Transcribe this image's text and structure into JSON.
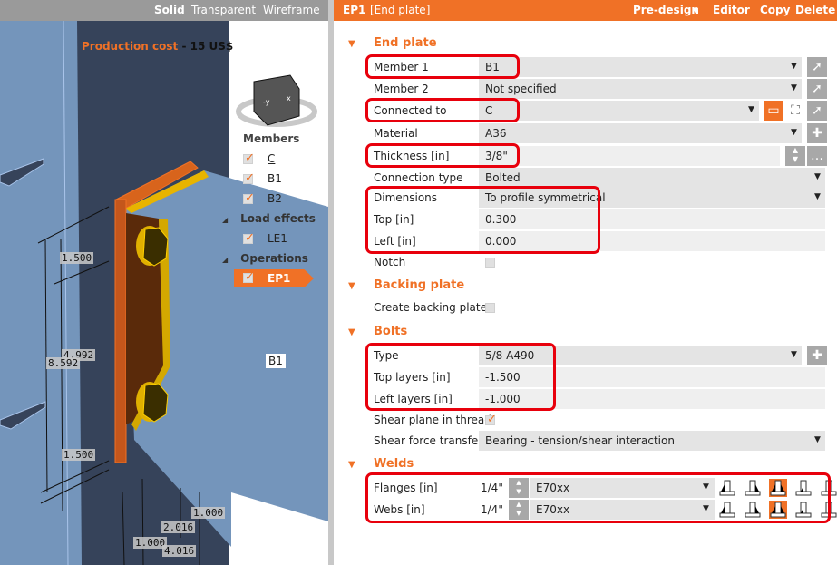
{
  "view_tabs": [
    "Solid",
    "Transparent",
    "Wireframe"
  ],
  "production_cost": {
    "label": "Production cost",
    "sep": "-",
    "value": "15 US$"
  },
  "tree": {
    "members_label": "Members",
    "members": [
      "C",
      "B1",
      "B2"
    ],
    "load_effects_label": "Load effects",
    "load_effects": [
      "LE1"
    ],
    "operations_label": "Operations",
    "operations": [
      "EP1"
    ]
  },
  "scene": {
    "beam_label": "B1",
    "dims": [
      "1.500",
      "4.992",
      "8.592",
      "1.500",
      "1.000",
      "2.016",
      "1.000",
      "4.016"
    ]
  },
  "header": {
    "id": "EP1",
    "type": "[End plate]",
    "predesign": "Pre-design",
    "editor": "Editor",
    "copy": "Copy",
    "delete": "Delete"
  },
  "end_plate": {
    "title": "End plate",
    "member1": {
      "label": "Member 1",
      "value": "B1"
    },
    "member2": {
      "label": "Member 2",
      "value": "Not specified"
    },
    "connected_to": {
      "label": "Connected to",
      "value": "C"
    },
    "material": {
      "label": "Material",
      "value": "A36"
    },
    "thickness": {
      "label": "Thickness [in]",
      "value": "3/8\""
    },
    "connection_type": {
      "label": "Connection type",
      "value": "Bolted"
    },
    "dimensions": {
      "label": "Dimensions",
      "value": "To profile symmetrical"
    },
    "top": {
      "label": "Top [in]",
      "value": "0.300"
    },
    "left": {
      "label": "Left [in]",
      "value": "0.000"
    },
    "notch": {
      "label": "Notch",
      "checked": false
    }
  },
  "backing_plate": {
    "title": "Backing plate",
    "create": {
      "label": "Create backing plate",
      "checked": false
    }
  },
  "bolts": {
    "title": "Bolts",
    "type": {
      "label": "Type",
      "value": "5/8 A490"
    },
    "top_layers": {
      "label": "Top layers [in]",
      "value": "-1.500"
    },
    "left_layers": {
      "label": "Left layers [in]",
      "value": "-1.000"
    },
    "shear_plane": {
      "label": "Shear plane in thread",
      "checked": true
    },
    "shear_force": {
      "label": "Shear force transfer",
      "value": "Bearing - tension/shear interaction"
    }
  },
  "welds": {
    "title": "Welds",
    "flanges": {
      "label": "Flanges [in]",
      "size": "1/4\"",
      "type": "E70xx",
      "selected_icon": 2
    },
    "webs": {
      "label": "Webs [in]",
      "size": "1/4\"",
      "type": "E70xx",
      "selected_icon": 2
    }
  },
  "colors": {
    "accent": "#f07126",
    "highlight": "#e8000c"
  }
}
